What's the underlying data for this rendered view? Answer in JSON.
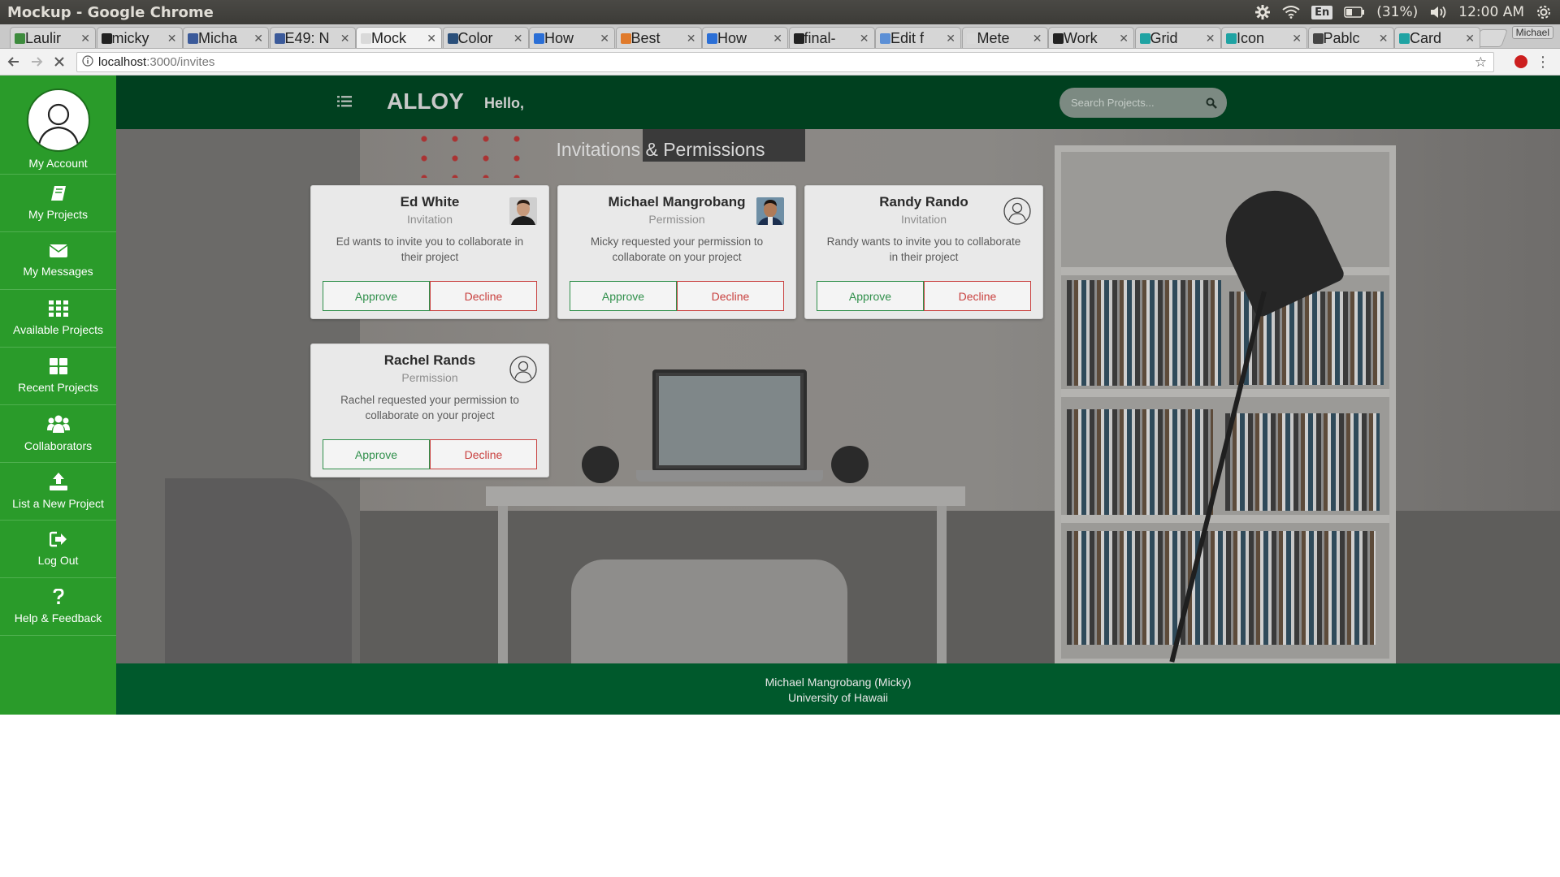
{
  "os": {
    "window_title": "Mockup - Google Chrome",
    "lang": "En",
    "battery": "(31%)",
    "time": "12:00 AM"
  },
  "browser": {
    "tabs": [
      {
        "label": "Laulir",
        "color": "#3d8b3d"
      },
      {
        "label": "micky",
        "color": "#222222"
      },
      {
        "label": "Micha",
        "color": "#3b5a9a"
      },
      {
        "label": "E49: N",
        "color": "#3b5a9a"
      },
      {
        "label": "Mock",
        "color": "#d9d9d9"
      },
      {
        "label": "Color",
        "color": "#2a4f7a"
      },
      {
        "label": "How",
        "color": "#2b6fd6"
      },
      {
        "label": "Best",
        "color": "#e07a2b"
      },
      {
        "label": "How",
        "color": "#2b6fd6"
      },
      {
        "label": "final-",
        "color": "#222222"
      },
      {
        "label": "Edit f",
        "color": "#5b8fd6"
      },
      {
        "label": "Mete",
        "color": "#d9d9d9"
      },
      {
        "label": "Work",
        "color": "#222222"
      },
      {
        "label": "Grid",
        "color": "#1fa3a3"
      },
      {
        "label": "Icon",
        "color": "#1fa3a3"
      },
      {
        "label": "Pablc",
        "color": "#444444"
      },
      {
        "label": "Card",
        "color": "#1fa3a3"
      }
    ],
    "active_tab": 4,
    "profile": "Michael",
    "url_host": "localhost",
    "url_path": ":3000/invites"
  },
  "sidebar": {
    "account_label": "My Account",
    "items": [
      {
        "label": "My Projects",
        "icon": "book-icon"
      },
      {
        "label": "My Messages",
        "icon": "envelope-icon"
      },
      {
        "label": "Available Projects",
        "icon": "grid-icon"
      },
      {
        "label": "Recent Projects",
        "icon": "th-large-icon"
      },
      {
        "label": "Collaborators",
        "icon": "users-icon"
      },
      {
        "label": "List a New Project",
        "icon": "upload-icon"
      },
      {
        "label": "Log Out",
        "icon": "logout-icon"
      },
      {
        "label": "Help & Feedback",
        "icon": "question-icon"
      }
    ]
  },
  "header": {
    "brand": "ALLOY",
    "greeting": "Hello,",
    "search_placeholder": "Search Projects..."
  },
  "page": {
    "heading": "Invitations & Permissions"
  },
  "cards": [
    {
      "name": "Ed White",
      "type": "Invitation",
      "desc": "Ed wants to invite you to collaborate in their project",
      "photo": "photo",
      "approve": "Approve",
      "decline": "Decline"
    },
    {
      "name": "Michael Mangrobang",
      "type": "Permission",
      "desc": "Micky requested your permission to collaborate on your project",
      "photo": "photo",
      "approve": "Approve",
      "decline": "Decline"
    },
    {
      "name": "Randy Rando",
      "type": "Invitation",
      "desc": "Randy wants to invite you to collaborate in their project",
      "photo": "placeholder",
      "approve": "Approve",
      "decline": "Decline"
    },
    {
      "name": "Rachel Rands",
      "type": "Permission",
      "desc": "Rachel requested your permission to collaborate on your project",
      "photo": "placeholder",
      "approve": "Approve",
      "decline": "Decline"
    }
  ],
  "footer": {
    "line1": "Michael Mangrobang (Micky)",
    "line2": "University of Hawaii"
  },
  "colors": {
    "sidebar": "#2a9b2a",
    "topnav": "#00401f",
    "footer": "#00592c",
    "approve": "#2f8f4a",
    "decline": "#c9413f"
  }
}
